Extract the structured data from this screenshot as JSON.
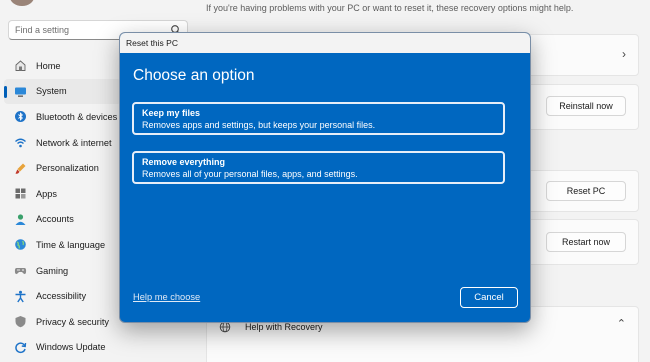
{
  "search": {
    "placeholder": "Find a setting"
  },
  "sidebar": {
    "items": [
      {
        "label": "Home",
        "icon": "home-icon"
      },
      {
        "label": "System",
        "icon": "system-icon",
        "active": true
      },
      {
        "label": "Bluetooth & devices",
        "icon": "bluetooth-icon"
      },
      {
        "label": "Network & internet",
        "icon": "wifi-icon"
      },
      {
        "label": "Personalization",
        "icon": "brush-icon"
      },
      {
        "label": "Apps",
        "icon": "apps-icon"
      },
      {
        "label": "Accounts",
        "icon": "accounts-icon"
      },
      {
        "label": "Time & language",
        "icon": "globe-icon"
      },
      {
        "label": "Gaming",
        "icon": "gamepad-icon"
      },
      {
        "label": "Accessibility",
        "icon": "accessibility-icon"
      },
      {
        "label": "Privacy & security",
        "icon": "shield-icon"
      },
      {
        "label": "Windows Update",
        "icon": "update-icon"
      }
    ]
  },
  "main": {
    "intro": "If you're having problems with your PC or want to reset it, these recovery options might help.",
    "reinstall_label": "Reinstall now",
    "reset_label": "Reset PC",
    "restart_label": "Restart now",
    "help_recovery_label": "Help with Recovery"
  },
  "dialog": {
    "title": "Reset this PC",
    "heading": "Choose an option",
    "options": [
      {
        "title": "Keep my files",
        "description": "Removes apps and settings, but keeps your personal files."
      },
      {
        "title": "Remove everything",
        "description": "Removes all of your personal files, apps, and settings."
      }
    ],
    "help_link": "Help me choose",
    "cancel_label": "Cancel"
  },
  "colors": {
    "accent": "#005fb8",
    "dialog_bg": "#0067c0"
  }
}
